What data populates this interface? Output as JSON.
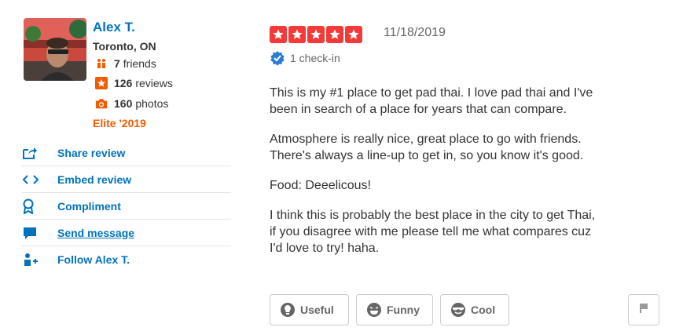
{
  "user": {
    "name": "Alex T.",
    "location": "Toronto, ON",
    "friends_count": "7",
    "friends_label": "friends",
    "reviews_count": "126",
    "reviews_label": "reviews",
    "photos_count": "160",
    "photos_label": "photos",
    "elite": "Elite '2019"
  },
  "actions": [
    {
      "label": "Share review",
      "icon": "share-icon"
    },
    {
      "label": "Embed review",
      "icon": "embed-icon"
    },
    {
      "label": "Compliment",
      "icon": "award-ribbon-icon"
    },
    {
      "label": "Send message",
      "icon": "chat-bubble-icon"
    },
    {
      "label": "Follow Alex T.",
      "icon": "follow-user-icon"
    }
  ],
  "review": {
    "rating": 5,
    "date": "11/18/2019",
    "checkins": "1 check-in",
    "paragraphs": [
      "This is my #1 place to get pad thai. I love pad thai and I've\nbeen in search of a place for years that can compare.",
      "Atmosphere is really nice, great place to go with friends.\nThere's always a line-up to get in, so you know it's good.",
      "Food: Deeelicous!",
      "I think this is probably the best place in the city to get Thai,\nif you disagree with me please tell me what compares cuz\nI'd love to try! haha."
    ]
  },
  "votes": {
    "useful": "Useful",
    "funny": "Funny",
    "cool": "Cool"
  },
  "colors": {
    "link": "#0073bb",
    "star": "#f43939",
    "elite": "#f15c00"
  }
}
